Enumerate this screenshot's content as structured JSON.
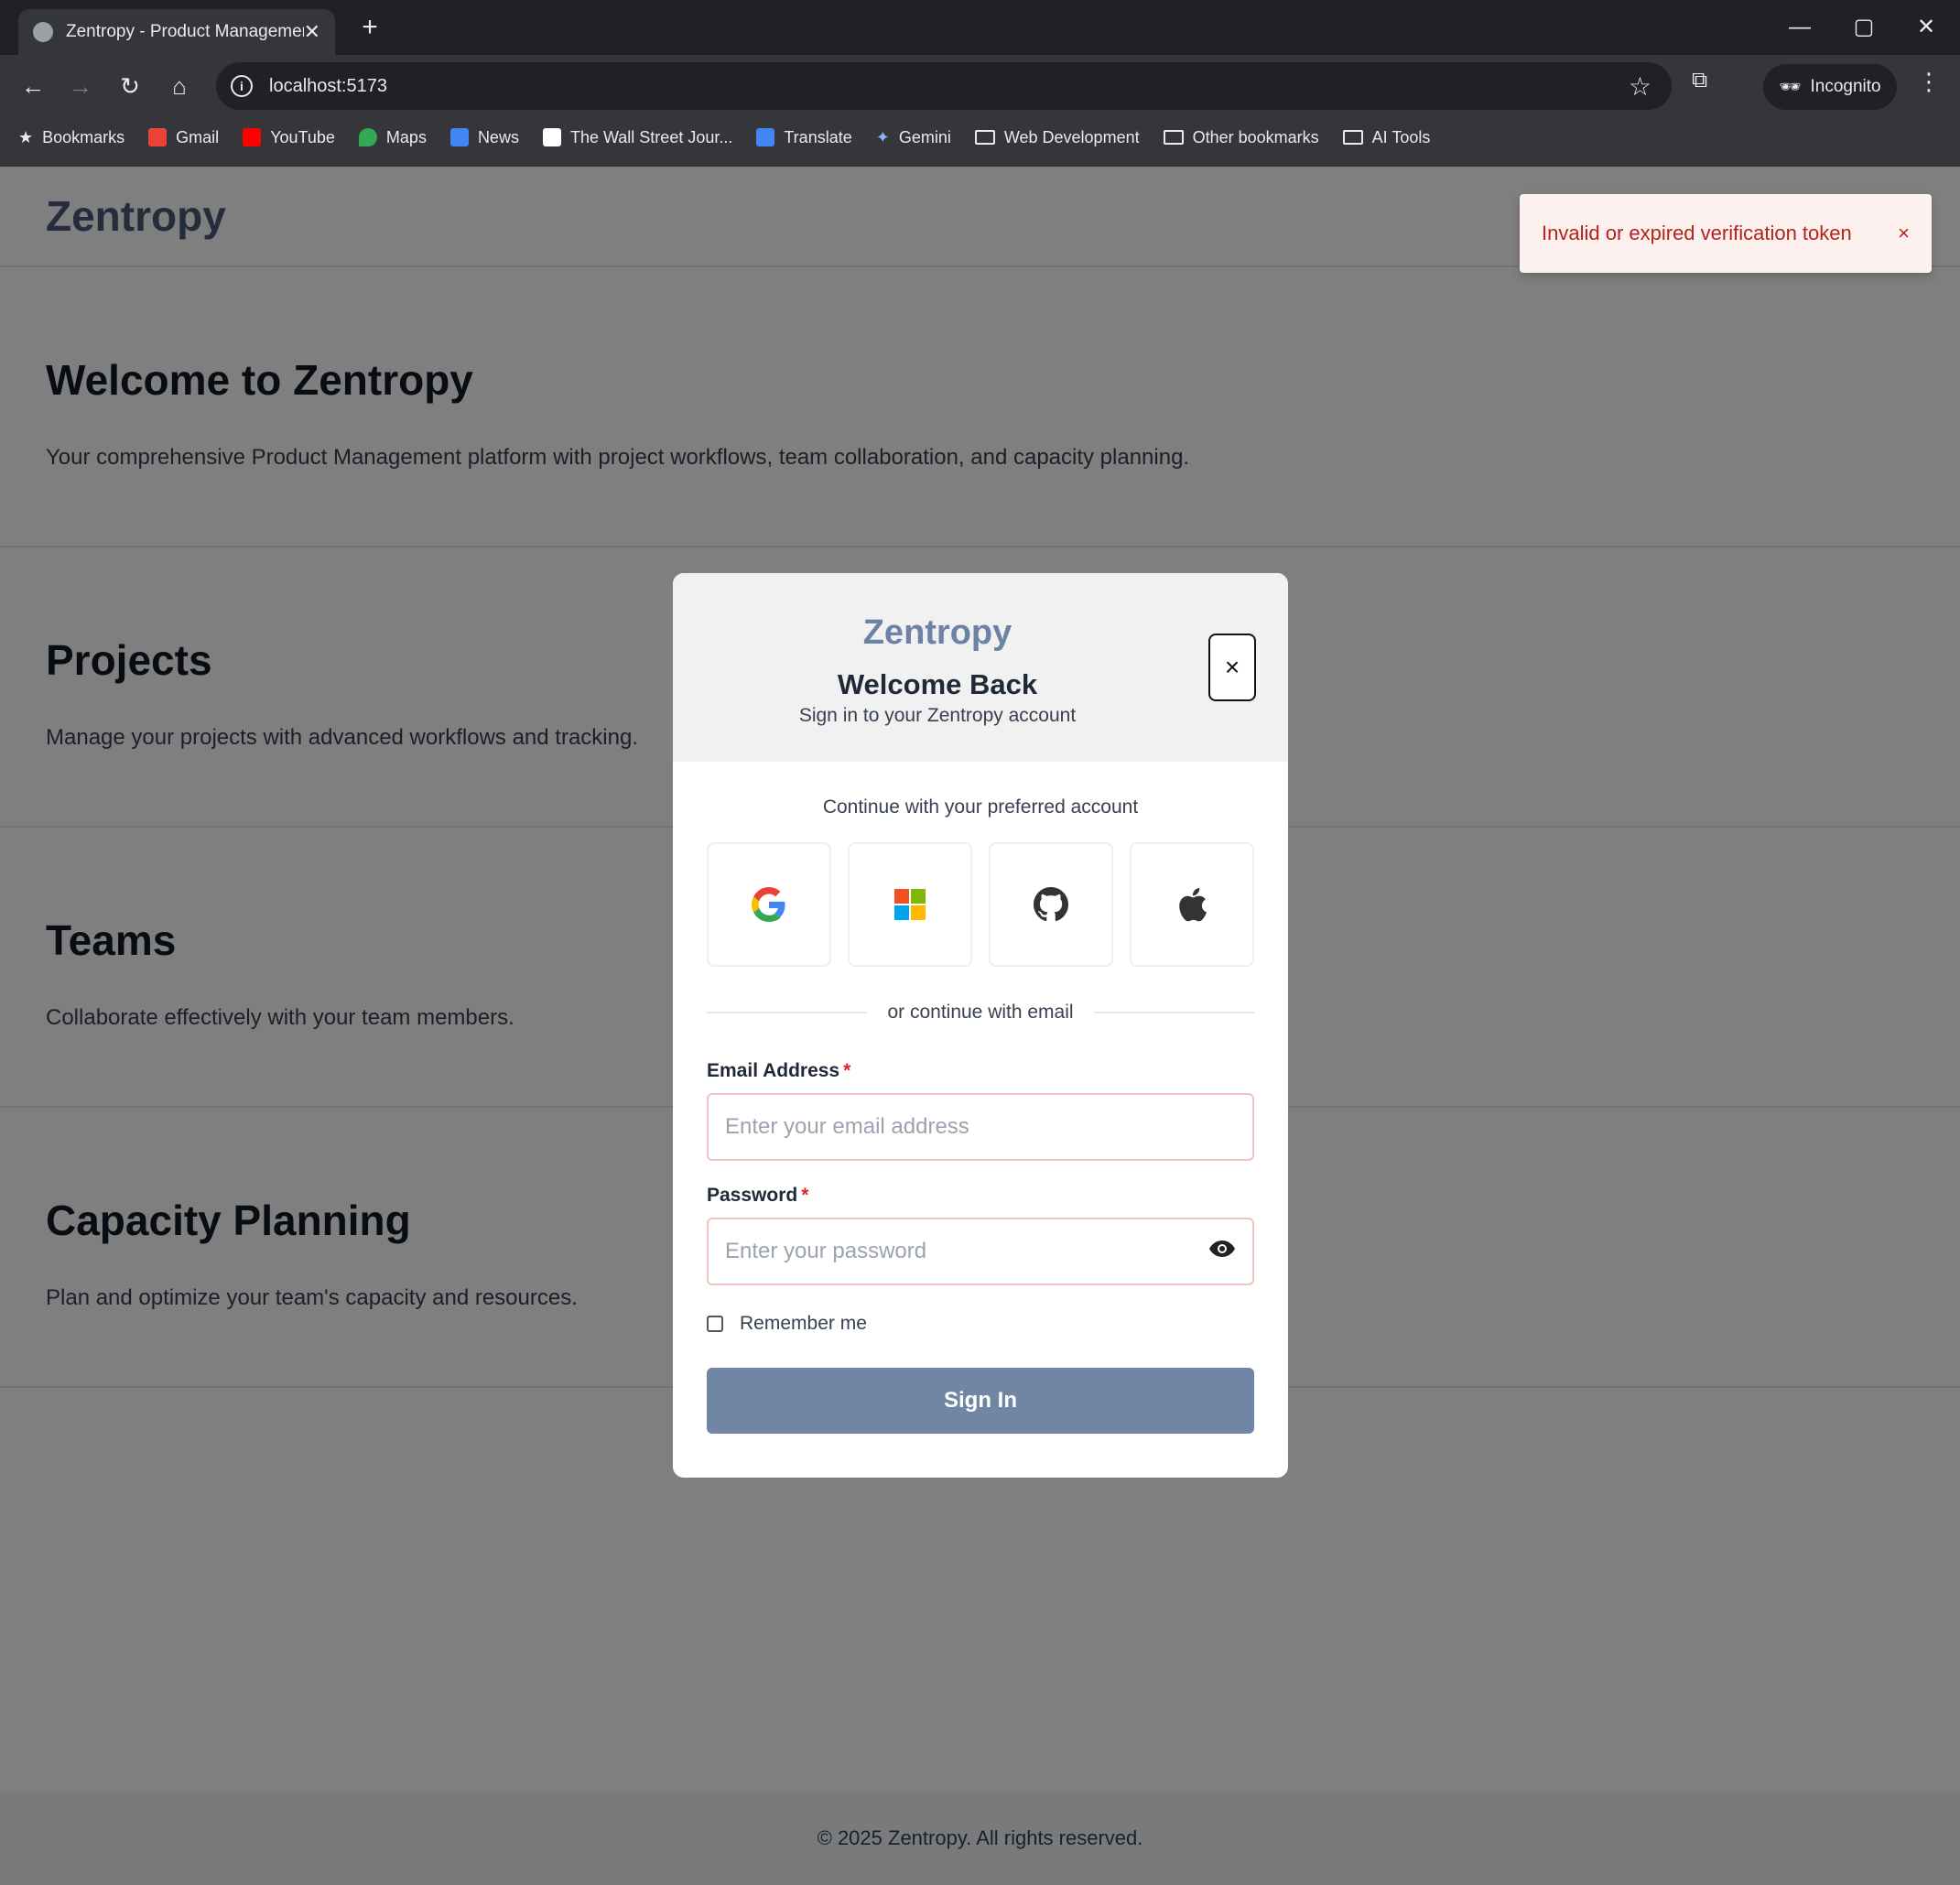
{
  "browser": {
    "tab_title": "Zentropy - Product Management",
    "url": "localhost:5173",
    "incognito_label": "Incognito",
    "bookmarks": [
      {
        "label": "Bookmarks",
        "icon": "star-icon"
      },
      {
        "label": "Gmail",
        "icon": "gmail-icon"
      },
      {
        "label": "YouTube",
        "icon": "youtube-icon"
      },
      {
        "label": "Maps",
        "icon": "maps-icon"
      },
      {
        "label": "News",
        "icon": "news-icon"
      },
      {
        "label": "The Wall Street Jour...",
        "icon": "wsj-icon"
      },
      {
        "label": "Translate",
        "icon": "translate-icon"
      },
      {
        "label": "Gemini",
        "icon": "gemini-icon"
      },
      {
        "label": "Web Development",
        "icon": "folder-icon"
      },
      {
        "label": "Other bookmarks",
        "icon": "folder-icon"
      },
      {
        "label": "AI Tools",
        "icon": "folder-icon"
      }
    ]
  },
  "page": {
    "logo": "Zentropy",
    "sections": [
      {
        "title": "Welcome to Zentropy",
        "text": "Your comprehensive Product Management platform with project workflows, team collaboration, and capacity planning."
      },
      {
        "title": "Projects",
        "text": "Manage your projects with advanced workflows and tracking."
      },
      {
        "title": "Teams",
        "text": "Collaborate effectively with your team members."
      },
      {
        "title": "Capacity Planning",
        "text": "Plan and optimize your team's capacity and resources."
      }
    ],
    "footer": "© 2025 Zentropy. All rights reserved."
  },
  "toast": {
    "message": "Invalid or expired verification token",
    "close": "×"
  },
  "modal": {
    "brand": "Zentropy",
    "title": "Welcome Back",
    "subtitle": "Sign in to your Zentropy account",
    "close": "×",
    "prefer_text": "Continue with your preferred account",
    "providers": [
      "google-icon",
      "microsoft-icon",
      "github-icon",
      "apple-icon"
    ],
    "divider_text": "or continue with email",
    "email_label": "Email Address",
    "email_placeholder": "Enter your email address",
    "password_label": "Password",
    "password_placeholder": "Enter your password",
    "required_mark": "*",
    "remember_label": "Remember me",
    "signin_label": "Sign In"
  },
  "colors": {
    "accent": "#7186a4",
    "brand": "#6d82a6",
    "error": "#b42318",
    "toast_bg": "#fdf1f0"
  }
}
